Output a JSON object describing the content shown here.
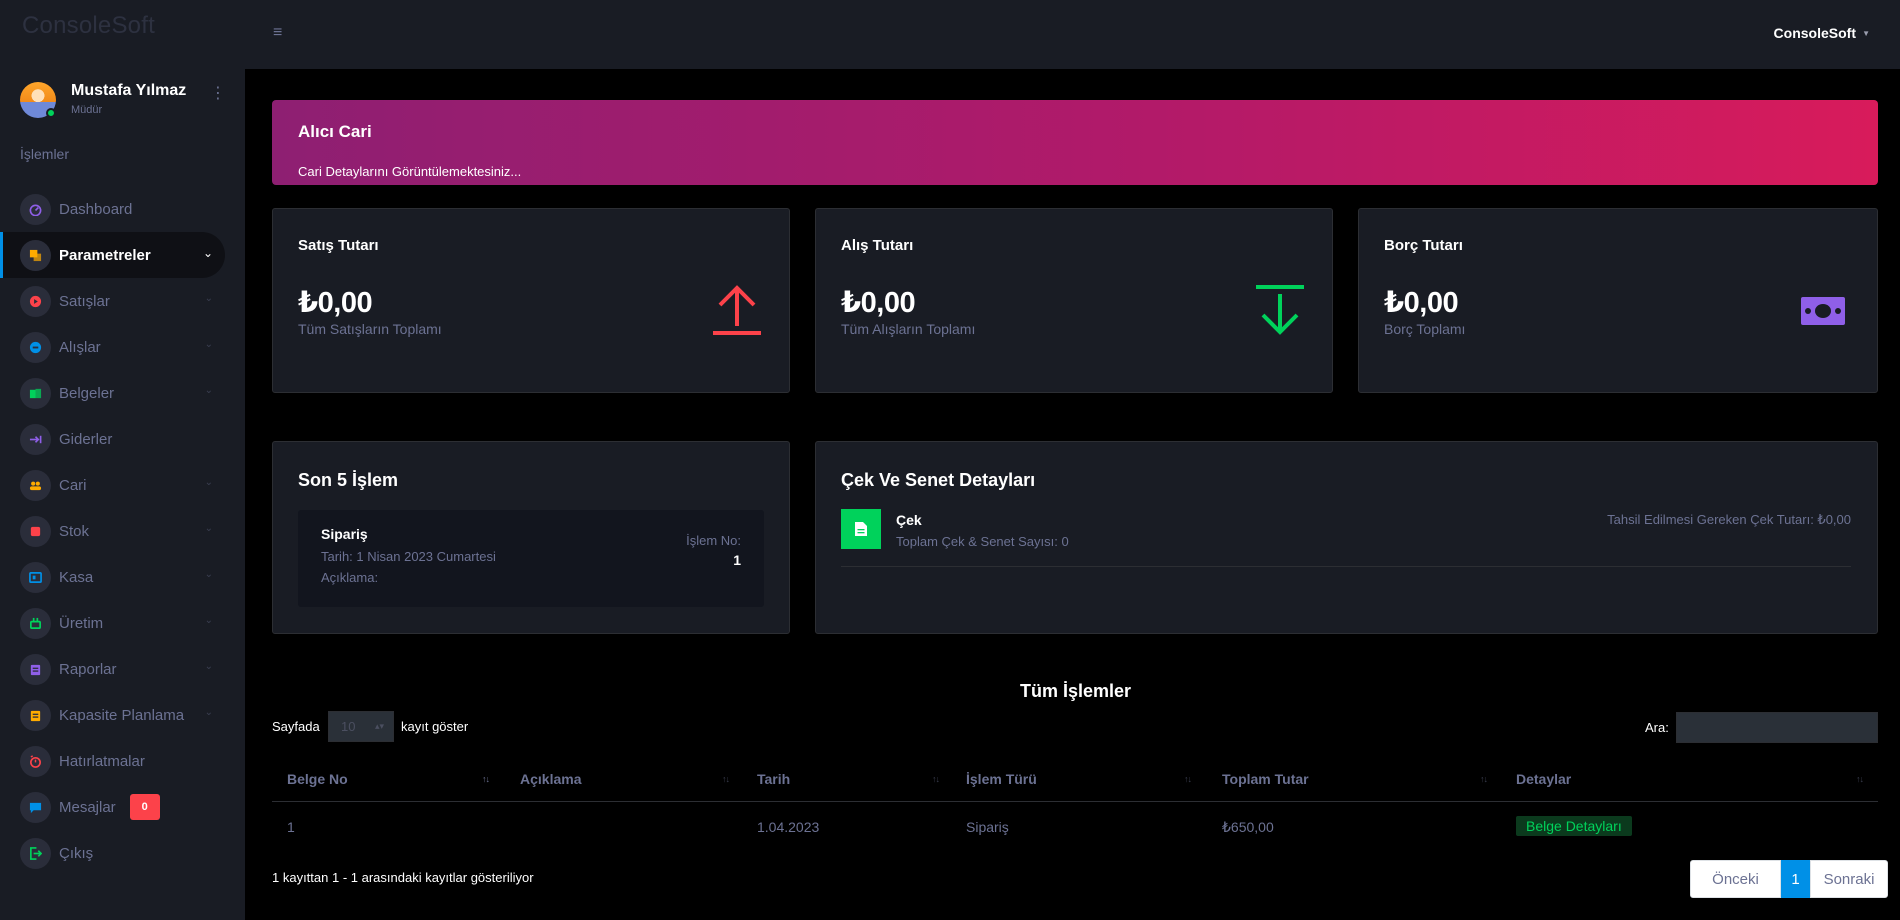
{
  "brand": "ConsoleSoft",
  "profile": {
    "name": "Mustafa Yılmaz",
    "role": "Müdür"
  },
  "sidebar": {
    "section_title": "İşlemler",
    "items": [
      {
        "label": "Dashboard",
        "icon": "speedometer-icon",
        "color": "#8f5fe8",
        "chevron": false
      },
      {
        "label": "Parametreler",
        "icon": "layers-icon",
        "color": "#ffab00",
        "chevron": true,
        "active": true
      },
      {
        "label": "Satışlar",
        "icon": "play-circle-icon",
        "color": "#fc424a",
        "chevron": true
      },
      {
        "label": "Alışlar",
        "icon": "cart-icon",
        "color": "#0090e7",
        "chevron": true
      },
      {
        "label": "Belgeler",
        "icon": "documents-icon",
        "color": "#00d25b",
        "chevron": true
      },
      {
        "label": "Giderler",
        "icon": "arrow-right-bar-icon",
        "color": "#8f5fe8",
        "chevron": false
      },
      {
        "label": "Cari",
        "icon": "users-icon",
        "color": "#ffab00",
        "chevron": true
      },
      {
        "label": "Stok",
        "icon": "box-icon",
        "color": "#fc424a",
        "chevron": true
      },
      {
        "label": "Kasa",
        "icon": "cash-register-icon",
        "color": "#0090e7",
        "chevron": true
      },
      {
        "label": "Üretim",
        "icon": "factory-icon",
        "color": "#00d25b",
        "chevron": true
      },
      {
        "label": "Raporlar",
        "icon": "clipboard-icon",
        "color": "#8f5fe8",
        "chevron": true
      },
      {
        "label": "Kapasite Planlama",
        "icon": "clipboard-list-icon",
        "color": "#ffab00",
        "chevron": true
      },
      {
        "label": "Hatırlatmalar",
        "icon": "alarm-icon",
        "color": "#fc424a",
        "chevron": false
      },
      {
        "label": "Mesajlar",
        "icon": "message-icon",
        "color": "#0090e7",
        "chevron": false,
        "badge": "0"
      },
      {
        "label": "Çıkış",
        "icon": "logout-icon",
        "color": "#00d25b",
        "chevron": false
      }
    ]
  },
  "topbar": {
    "menu_icon": "hamburger-icon",
    "user": "ConsoleSoft"
  },
  "banner": {
    "title": "Alıcı Cari",
    "subtitle": "Cari Detaylarını Görüntülemektesiniz..."
  },
  "stats": [
    {
      "title": "Satış Tutarı",
      "amount": "₺0,00",
      "subtitle": "Tüm Satışların Toplamı",
      "icon": "arrow-up-icon",
      "color": "#fc424a"
    },
    {
      "title": "Alış Tutarı",
      "amount": "₺0,00",
      "subtitle": "Tüm Alışların Toplamı",
      "icon": "arrow-down-icon",
      "color": "#00d25b"
    },
    {
      "title": "Borç Tutarı",
      "amount": "₺0,00",
      "subtitle": "Borç Toplamı",
      "icon": "cash-icon",
      "color": "#8f5fe8"
    }
  ],
  "last5": {
    "title": "Son 5 İşlem",
    "item": {
      "type": "Sipariş",
      "date": "Tarih: 1 Nisan 2023 Cumartesi",
      "desc": "Açıklama:",
      "no_label": "İşlem No:",
      "no": "1"
    }
  },
  "cek": {
    "title": "Çek Ve Senet Detayları",
    "item_title": "Çek",
    "item_sub": "Toplam Çek & Senet Sayısı: 0",
    "right": "Tahsil Edilmesi Gereken Çek Tutarı: ₺0,00",
    "icon": "file-document-icon"
  },
  "table": {
    "title": "Tüm İşlemler",
    "length_label": "Sayfada",
    "length_value": "10",
    "length_after": "kayıt göster",
    "search_label": "Ara:",
    "search_value": "",
    "columns": [
      "Belge No",
      "Açıklama",
      "Tarih",
      "İşlem Türü",
      "Toplam Tutar",
      "Detaylar"
    ],
    "rows": [
      {
        "belge_no": "1",
        "aciklama": "",
        "tarih": "1.04.2023",
        "tur": "Sipariş",
        "tutar": "₺650,00",
        "detay": "Belge Detayları"
      }
    ],
    "info": "1 kayıttan 1 - 1 arasındaki kayıtlar gösteriliyor",
    "pagination": {
      "prev": "Önceki",
      "current": "1",
      "next": "Sonraki"
    }
  }
}
